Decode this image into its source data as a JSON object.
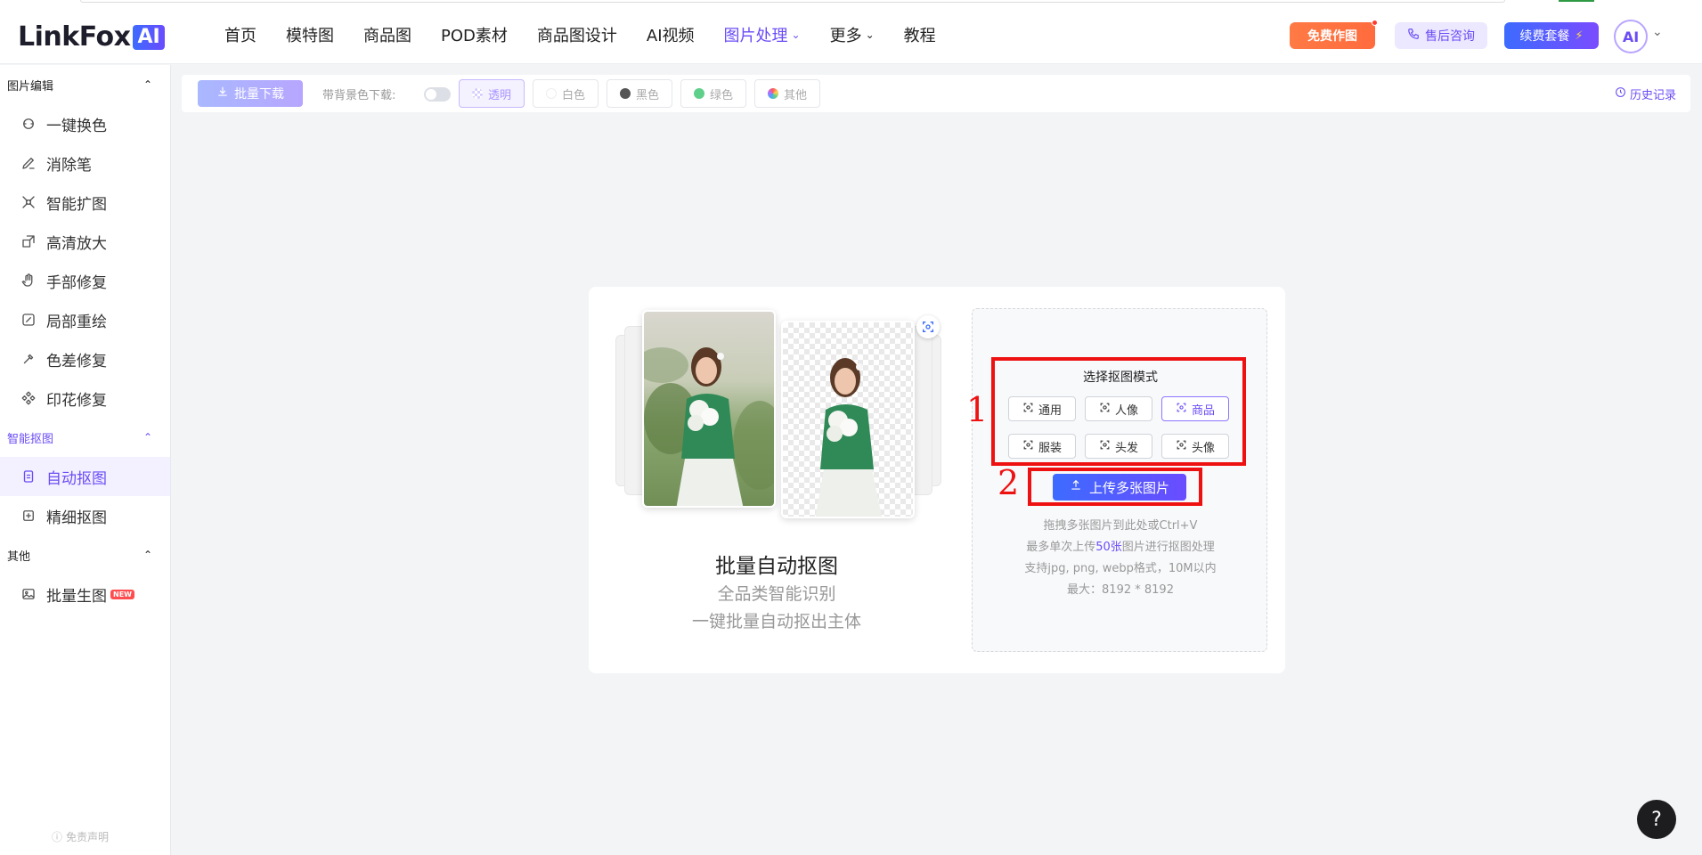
{
  "brand": {
    "name": "LinkFox",
    "badge": "AI"
  },
  "nav": [
    {
      "label": "首页",
      "active": false,
      "dropdown": false
    },
    {
      "label": "模特图",
      "active": false,
      "dropdown": false
    },
    {
      "label": "商品图",
      "active": false,
      "dropdown": false
    },
    {
      "label": "POD素材",
      "active": false,
      "dropdown": false
    },
    {
      "label": "商品图设计",
      "active": false,
      "dropdown": false
    },
    {
      "label": "AI视频",
      "active": false,
      "dropdown": false
    },
    {
      "label": "图片处理",
      "active": true,
      "dropdown": true
    },
    {
      "label": "更多",
      "active": false,
      "dropdown": true
    },
    {
      "label": "教程",
      "active": false,
      "dropdown": false
    }
  ],
  "header_actions": {
    "free": "免费作图",
    "support": "售后咨询",
    "renew": "续费套餐",
    "avatar": "AI"
  },
  "sidebar": {
    "sections": [
      {
        "title": "图片编辑",
        "active": false,
        "items": [
          {
            "label": "一键换色",
            "icon": "color-swap-icon"
          },
          {
            "label": "消除笔",
            "icon": "eraser-pen-icon"
          },
          {
            "label": "智能扩图",
            "icon": "expand-icon"
          },
          {
            "label": "高清放大",
            "icon": "upscale-icon"
          },
          {
            "label": "手部修复",
            "icon": "hand-icon"
          },
          {
            "label": "局部重绘",
            "icon": "brush-icon"
          },
          {
            "label": "色差修复",
            "icon": "color-fix-icon"
          },
          {
            "label": "印花修复",
            "icon": "print-fix-icon"
          }
        ]
      },
      {
        "title": "智能抠图",
        "active": true,
        "items": [
          {
            "label": "自动抠图",
            "icon": "auto-cutout-icon",
            "active": true
          },
          {
            "label": "精细抠图",
            "icon": "fine-cutout-icon"
          }
        ]
      },
      {
        "title": "其他",
        "active": false,
        "items": [
          {
            "label": "批量生图",
            "icon": "image-icon",
            "badge": "NEW"
          }
        ]
      }
    ],
    "disclaimer": "免责声明"
  },
  "toolbar": {
    "download": "批量下载",
    "bg_label": "带背景色下载:",
    "bg_options": [
      {
        "label": "透明",
        "color": "checker",
        "active": true
      },
      {
        "label": "白色",
        "color": "#ffffff"
      },
      {
        "label": "黑色",
        "color": "#555555"
      },
      {
        "label": "绿色",
        "color": "#5fd08a"
      },
      {
        "label": "其他",
        "color": "rainbow"
      }
    ],
    "history": "历史记录"
  },
  "card": {
    "title": "批量自动抠图",
    "sub1": "全品类智能识别",
    "sub2": "一键批量自动抠出主体",
    "mode_title": "选择抠图模式",
    "modes": [
      {
        "label": "通用",
        "active": false
      },
      {
        "label": "人像",
        "active": false
      },
      {
        "label": "商品",
        "active": true
      },
      {
        "label": "服装",
        "active": false
      },
      {
        "label": "头发",
        "active": false
      },
      {
        "label": "头像",
        "active": false
      }
    ],
    "upload": "上传多张图片",
    "hint1": "拖拽多张图片到此处或Ctrl+V",
    "hint2_pre": "最多单次上传",
    "hint2_hl": "50张",
    "hint2_post": "图片进行抠图处理",
    "hint3": "支持jpg, png, webp格式，10M以内",
    "hint4": "最大：8192 * 8192"
  },
  "annotations": {
    "one": "1",
    "two": "2"
  },
  "help": "?"
}
